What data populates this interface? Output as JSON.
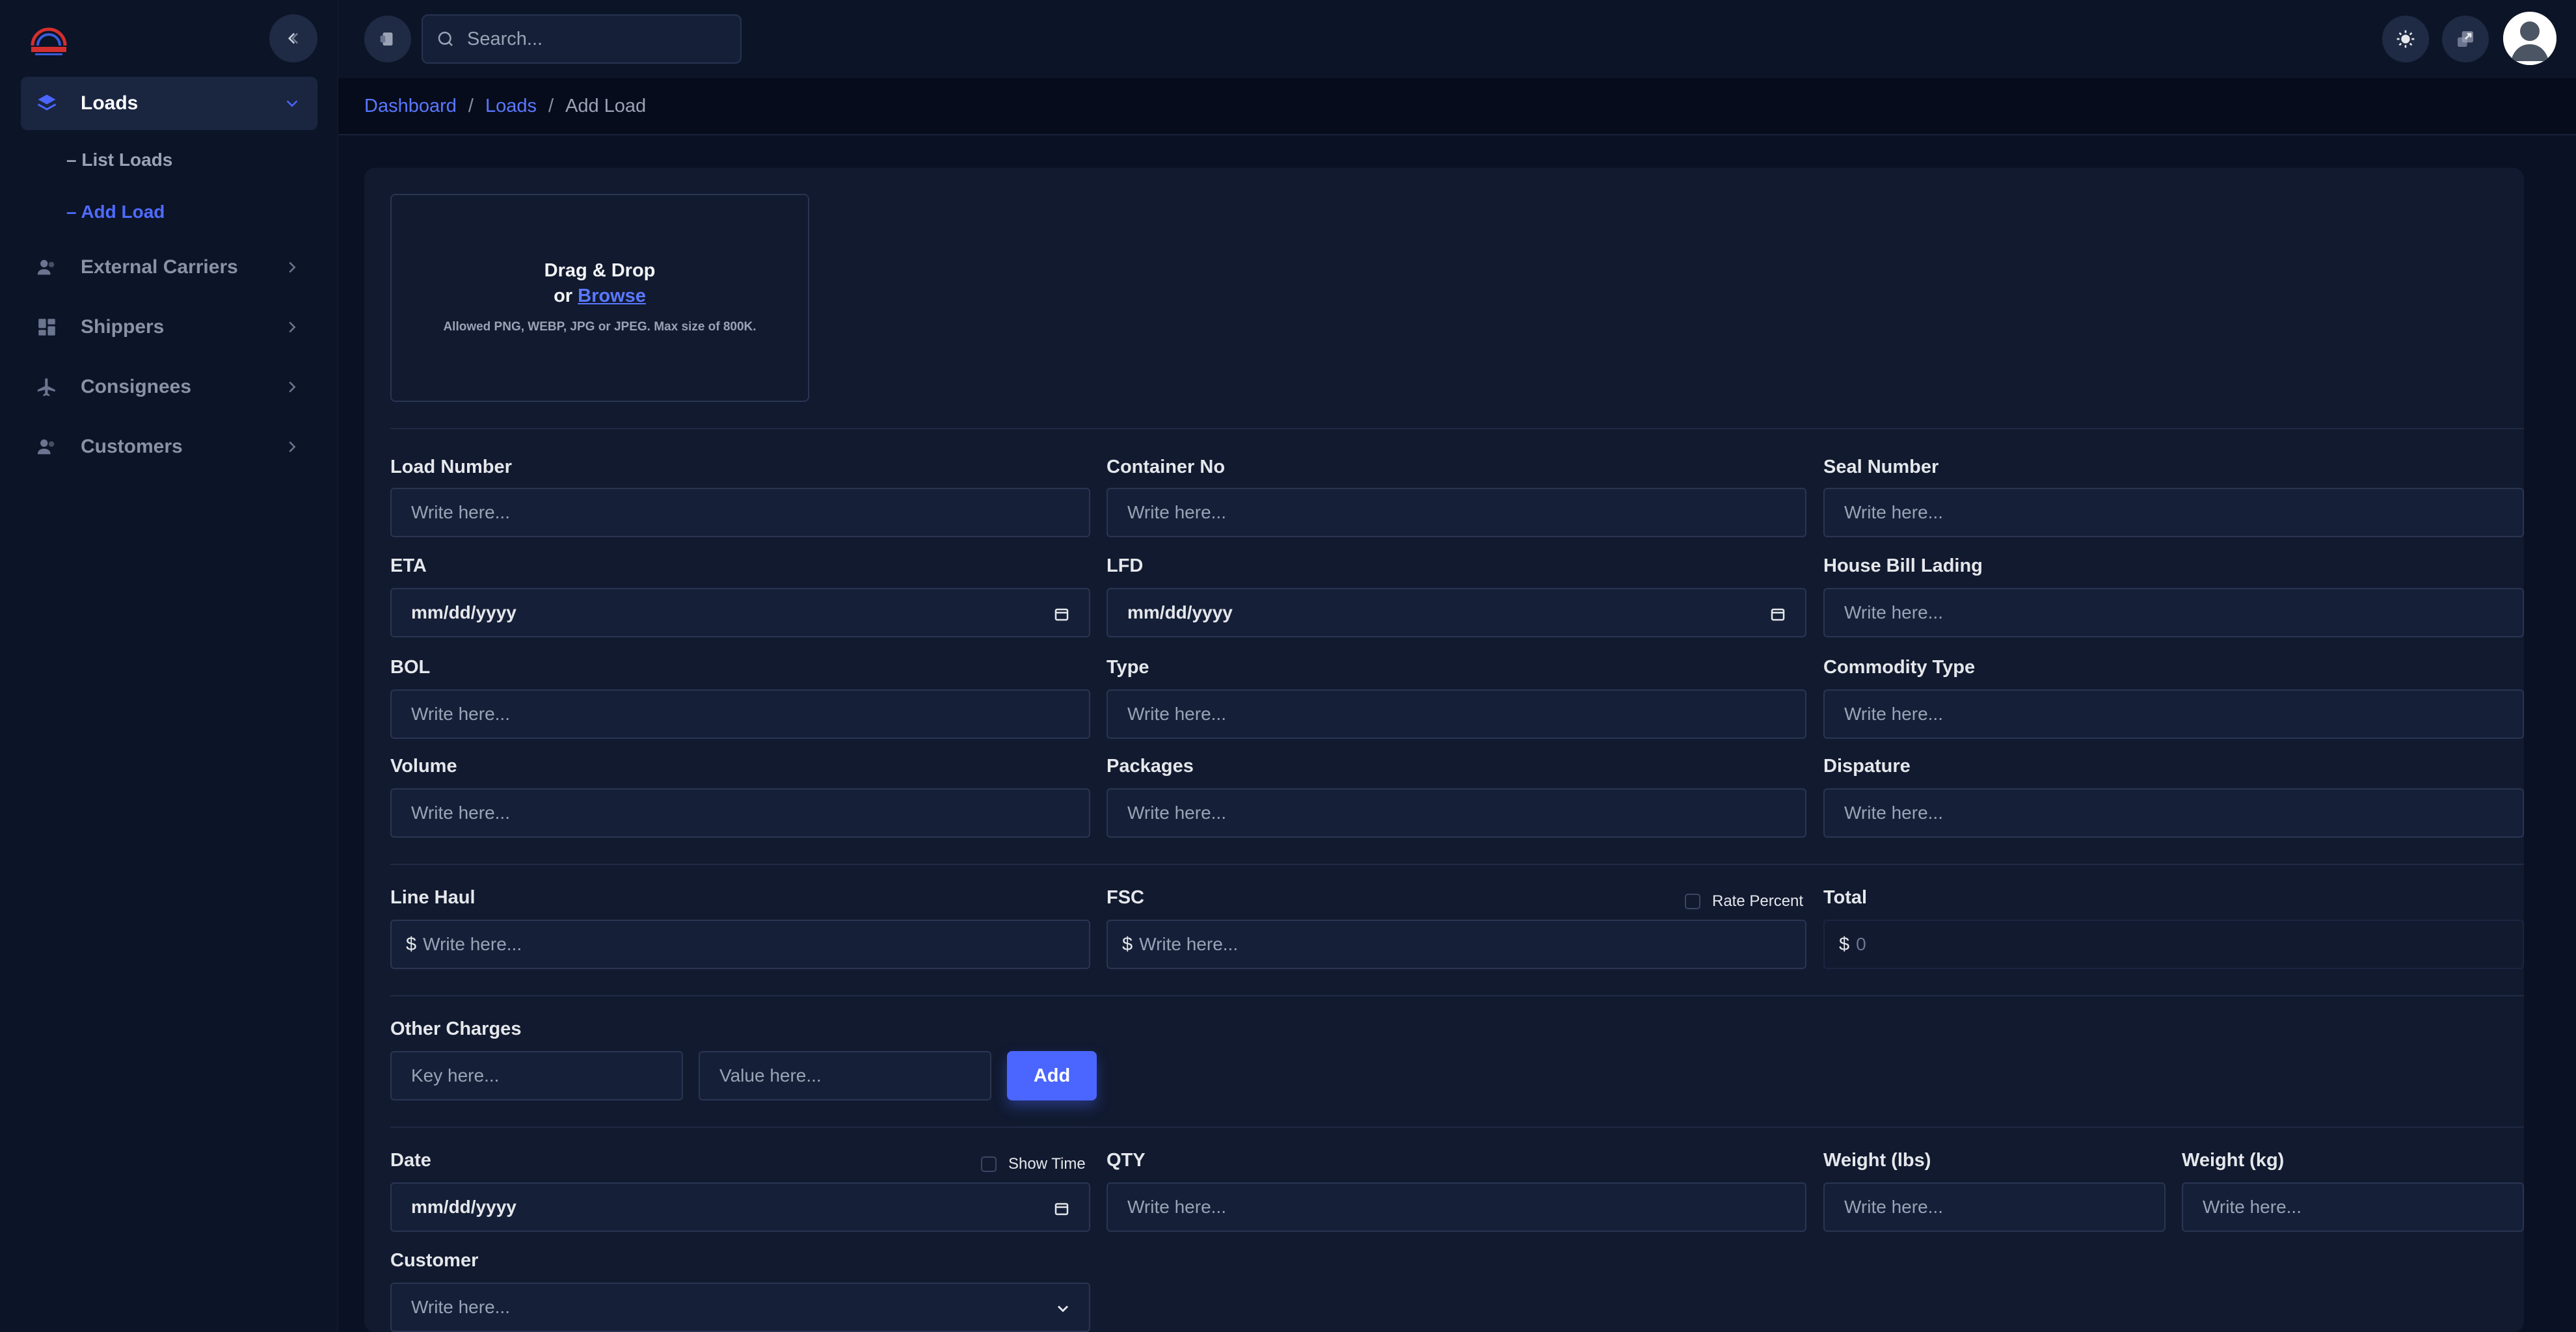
{
  "sidebar": {
    "items": [
      {
        "label": "Loads",
        "icon": "layers-icon",
        "active": true
      },
      {
        "label": "External Carriers",
        "icon": "users-icon"
      },
      {
        "label": "Shippers",
        "icon": "grid-icon"
      },
      {
        "label": "Consignees",
        "icon": "plane-icon"
      },
      {
        "label": "Customers",
        "icon": "users-icon"
      }
    ],
    "sub_items": [
      {
        "label": "– List Loads"
      },
      {
        "label": "– Add Load",
        "active": true
      }
    ]
  },
  "topbar": {
    "search_placeholder": "Search..."
  },
  "breadcrumb": {
    "items": [
      "Dashboard",
      "Loads",
      "Add Load"
    ],
    "sep": "/"
  },
  "dropzone": {
    "title": "Drag & Drop",
    "or": "or",
    "browse": "Browse",
    "note": "Allowed PNG, WEBP, JPG or JPEG. Max size of 800K."
  },
  "form": {
    "placeholder": "Write here...",
    "date_placeholder": "mm/dd/yyyy",
    "load_number": "Load Number",
    "container_no": "Container No",
    "seal_number": "Seal Number",
    "eta": "ETA",
    "lfd": "LFD",
    "house_bill_lading": "House Bill Lading",
    "bol": "BOL",
    "type": "Type",
    "commodity_type": "Commodity Type",
    "volume": "Volume",
    "packages": "Packages",
    "dispature": "Dispature",
    "line_haul": "Line Haul",
    "fsc": "FSC",
    "rate_percent": "Rate Percent",
    "total": "Total",
    "total_value": "0",
    "currency": "$",
    "other_charges": "Other Charges",
    "key_placeholder": "Key here...",
    "value_placeholder": "Value here...",
    "add_label": "Add",
    "date": "Date",
    "show_time": "Show Time",
    "qty": "QTY",
    "weight_lbs": "Weight (lbs)",
    "weight_kg": "Weight (kg)",
    "customer": "Customer"
  },
  "colors": {
    "accent": "#4a66ff",
    "background": "#0c1427",
    "card": "#111a2f"
  }
}
